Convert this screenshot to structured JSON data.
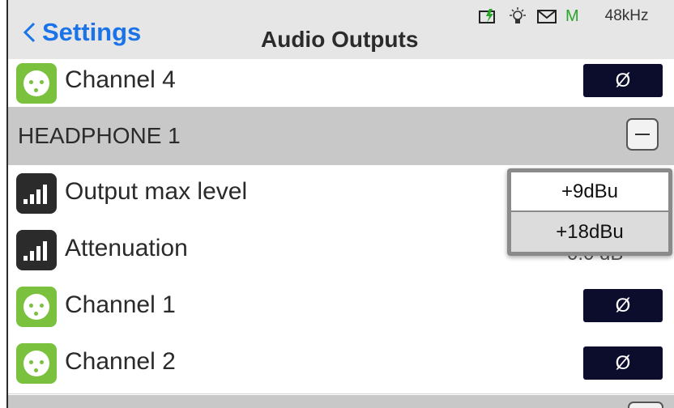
{
  "header": {
    "back_label": "Settings",
    "title": "Audio Outputs",
    "status": {
      "icons": [
        "battery-charging-icon",
        "lightbulb-icon",
        "mail-icon"
      ],
      "m_indicator": "M",
      "sample_rate": "48kHz"
    }
  },
  "rows": {
    "channel4": {
      "label": "Channel 4",
      "phase_symbol": "Ø"
    },
    "headphone_section": {
      "title": "HEADPHONE 1"
    },
    "output_max_level": {
      "label": "Output max level"
    },
    "attenuation": {
      "label": "Attenuation",
      "value_partial": "0.0 dB"
    },
    "channel1": {
      "label": "Channel 1",
      "phase_symbol": "Ø"
    },
    "channel2": {
      "label": "Channel 2",
      "phase_symbol": "Ø"
    }
  },
  "popup": {
    "options": [
      "+9dBu",
      "+18dBu"
    ],
    "selected": "+9dBu"
  },
  "colors": {
    "accent": "#1a73e8",
    "xlr_green": "#7ac13e",
    "phase_button": "#0c0c2c",
    "section_bg": "#c8c8c8",
    "header_bg": "#e6e6e6"
  }
}
